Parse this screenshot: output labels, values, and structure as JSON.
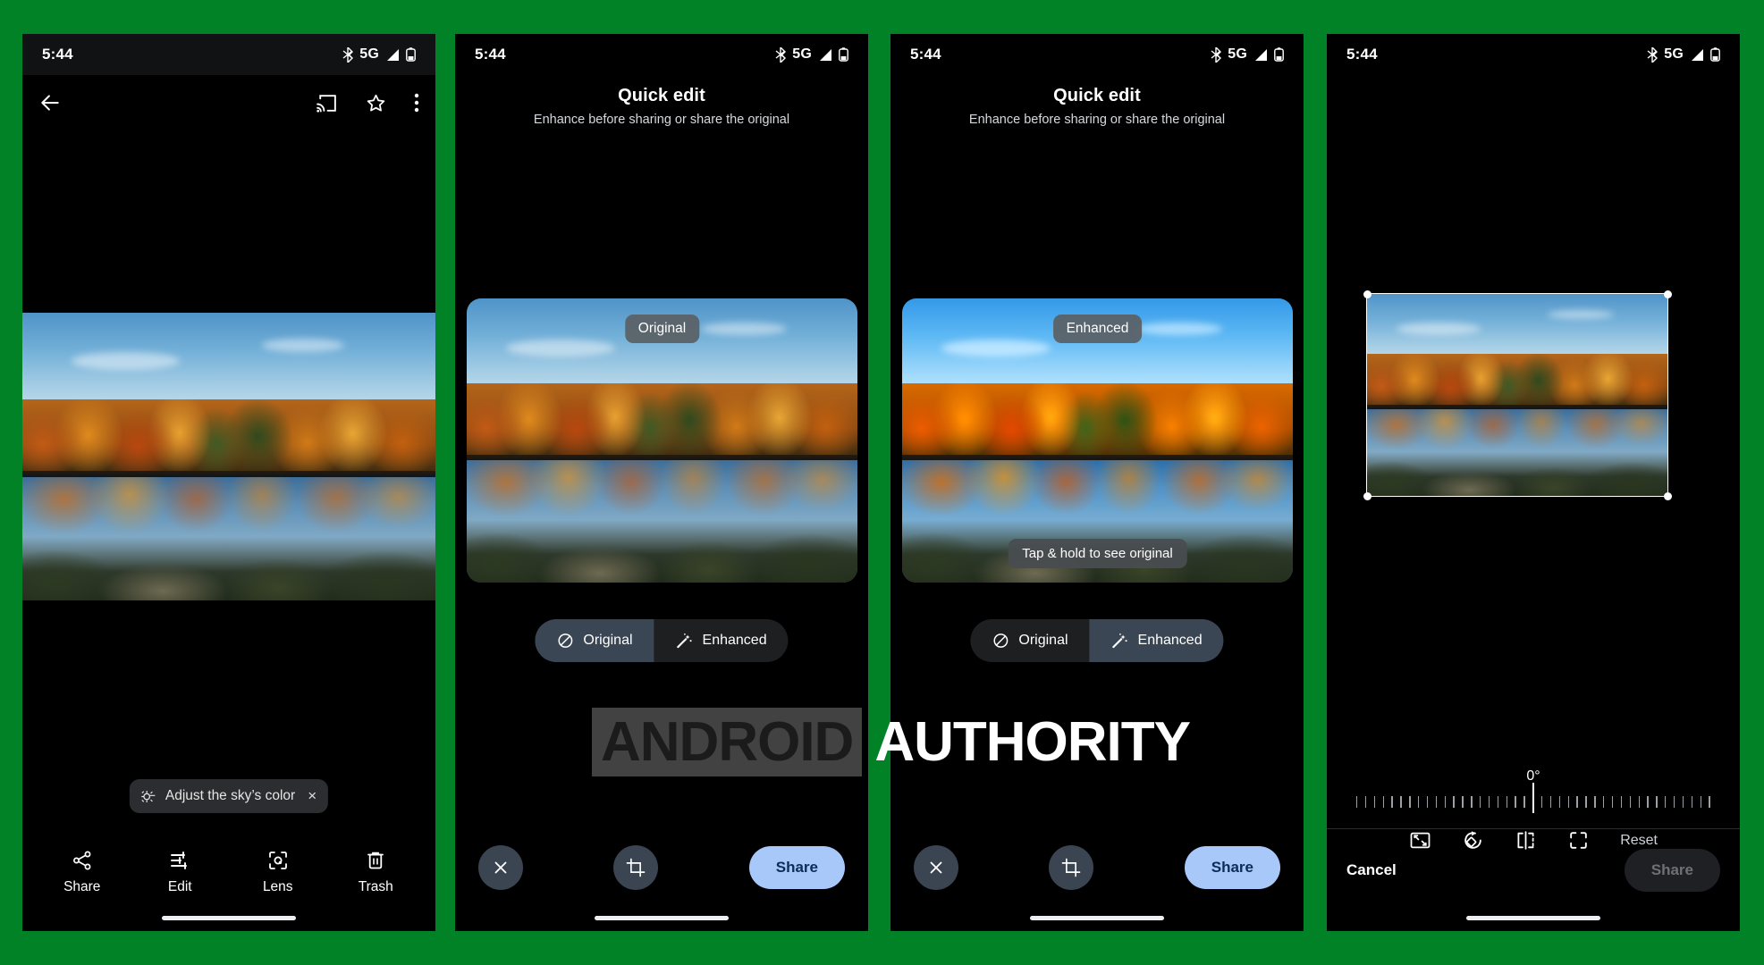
{
  "background_color": "#018227",
  "watermark": {
    "part1": "ANDROID",
    "part2": "AUTHORITY"
  },
  "status_bar": {
    "time": "5:44",
    "network": "5G",
    "icons": [
      "bluetooth-icon",
      "signal-icon",
      "battery-icon"
    ]
  },
  "panel1": {
    "name": "photo-viewer",
    "toolbar": {
      "back": "back-arrow-icon",
      "cast": "cast-icon",
      "favorite": "star-icon",
      "overflow": "more-vert-icon"
    },
    "suggestion_chip": {
      "label": "Adjust the sky’s color",
      "icon": "sky-color-icon",
      "close": "×"
    },
    "nav_items": [
      {
        "label": "Share",
        "icon": "share-icon"
      },
      {
        "label": "Edit",
        "icon": "tune-icon"
      },
      {
        "label": "Lens",
        "icon": "lens-icon"
      },
      {
        "label": "Trash",
        "icon": "trash-icon"
      }
    ]
  },
  "panel2": {
    "name": "quick-edit-original",
    "title": "Quick edit",
    "subtitle": "Enhance before sharing or share the original",
    "photo_badge": "Original",
    "segmented": [
      {
        "label": "Original",
        "icon": "no-effect-icon",
        "active": true
      },
      {
        "label": "Enhanced",
        "icon": "magic-wand-icon",
        "active": false
      }
    ],
    "bottom": {
      "close": "close-icon",
      "crop": "crop-icon",
      "share_label": "Share"
    }
  },
  "panel3": {
    "name": "quick-edit-enhanced",
    "title": "Quick edit",
    "subtitle": "Enhance before sharing or share the original",
    "photo_badge": "Enhanced",
    "photo_hint": "Tap & hold to see original",
    "segmented": [
      {
        "label": "Original",
        "icon": "no-effect-icon",
        "active": false
      },
      {
        "label": "Enhanced",
        "icon": "magic-wand-icon",
        "active": true
      }
    ],
    "bottom": {
      "close": "close-icon",
      "crop": "crop-icon",
      "share_label": "Share"
    }
  },
  "panel4": {
    "name": "crop-rotate-editor",
    "angle_label": "0°",
    "ruler_ticks": 41,
    "tools": [
      {
        "name": "aspect-ratio-icon"
      },
      {
        "name": "rotate-icon"
      },
      {
        "name": "flip-icon"
      },
      {
        "name": "reset-perspective-icon"
      }
    ],
    "reset_label": "Reset",
    "cancel_label": "Cancel",
    "share_label": "Share"
  }
}
